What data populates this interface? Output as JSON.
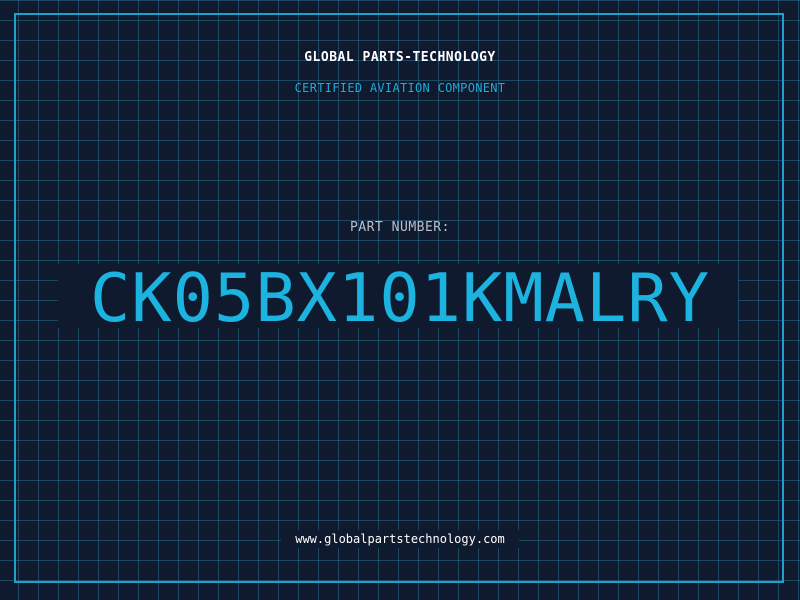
{
  "company": "GLOBAL PARTS-TECHNOLOGY",
  "tagline": "CERTIFIED AVIATION COMPONENT",
  "part": {
    "label": "PART NUMBER:",
    "number": "CK05BX101KMALRY"
  },
  "website": "www.globalpartstechnology.com",
  "colors": {
    "background": "#101a2e",
    "grid": "#286e8c",
    "accent": "#1cb3e0",
    "text": "#ffffff",
    "label": "#b8c0cc"
  }
}
